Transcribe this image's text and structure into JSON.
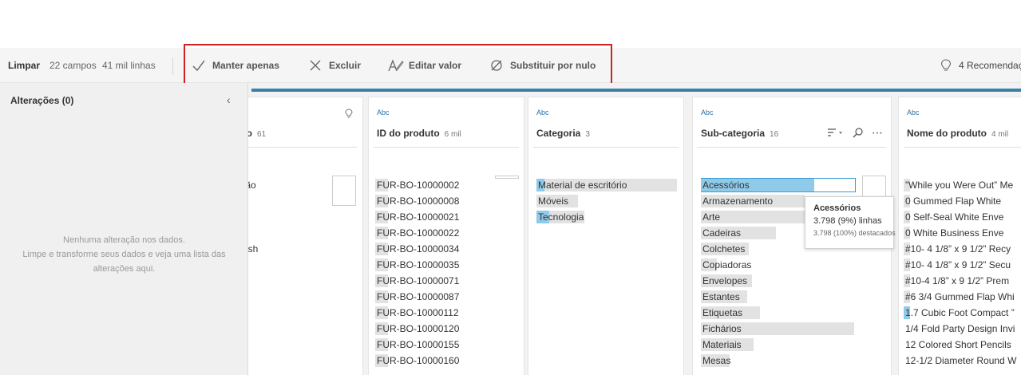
{
  "toolbar": {
    "clean_label": "Limpar",
    "fields": "22 campos",
    "rows": "41 mil linhas",
    "actions": {
      "keep_only": "Manter apenas",
      "exclude": "Excluir",
      "edit_value": "Editar valor",
      "replace_null": "Substituir por nulo"
    },
    "recommendations": "4 Recomendaç"
  },
  "changes": {
    "title": "Alterações (0)",
    "empty_line1": "Nenhuma alteração nos dados.",
    "empty_line2": "Limpe e transforme seus dados e veja uma lista das",
    "empty_line3": "alterações aqui."
  },
  "columns": [
    {
      "type": "",
      "title": "ão",
      "count": "61",
      "values": [
        "tão",
        "a",
        "a",
        "a",
        "esh",
        "s"
      ]
    },
    {
      "type": "Abc",
      "title": "ID do produto",
      "count": "6 mil",
      "values": [
        "FUR-BO-10000002",
        "FUR-BO-10000008",
        "FUR-BO-10000021",
        "FUR-BO-10000022",
        "FUR-BO-10000034",
        "FUR-BO-10000035",
        "FUR-BO-10000071",
        "FUR-BO-10000087",
        "FUR-BO-10000112",
        "FUR-BO-10000120",
        "FUR-BO-10000155",
        "FUR-BO-10000160"
      ]
    },
    {
      "type": "Abc",
      "title": "Categoria",
      "count": "3",
      "values": [
        "Material de escritório",
        "Móveis",
        "Tecnologia"
      ]
    },
    {
      "type": "Abc",
      "title": "Sub-categoria",
      "count": "16",
      "values": [
        "Acessórios",
        "Armazenamento",
        "Arte",
        "Cadeiras",
        "Colchetes",
        "Copiadoras",
        "Envelopes",
        "Estantes",
        "Etiquetas",
        "Fichários",
        "Materiais",
        "Mesas"
      ]
    },
    {
      "type": "Abc",
      "title": "Nome do produto",
      "count": "4 mil",
      "values": [
        "”While you Were Out” Me",
        "0 Gummed Flap White",
        "0 Self-Seal White Enve",
        "0 White Business Enve",
        "#10- 4 1/8” x 9 1/2” Recy",
        "#10- 4 1/8” x 9 1/2” Secu",
        "#10-4 1/8” x 9 1/2” Prem",
        "#6 3/4 Gummed Flap Whi",
        "1.7 Cubic Foot Compact ”",
        "1/4 Fold Party Design Invi",
        "12 Colored Short Pencils",
        "12-1/2 Diameter Round W"
      ]
    }
  ],
  "tooltip": {
    "title": "Acessórios",
    "line1": "3.798 (9%) linhas",
    "line2": "3.798 (100%) destacados"
  },
  "colors": {
    "accent": "#3c7fa6",
    "highlight": "#8fcbe9",
    "selection_border": "#cc2222",
    "type_label": "#2a6fad"
  }
}
